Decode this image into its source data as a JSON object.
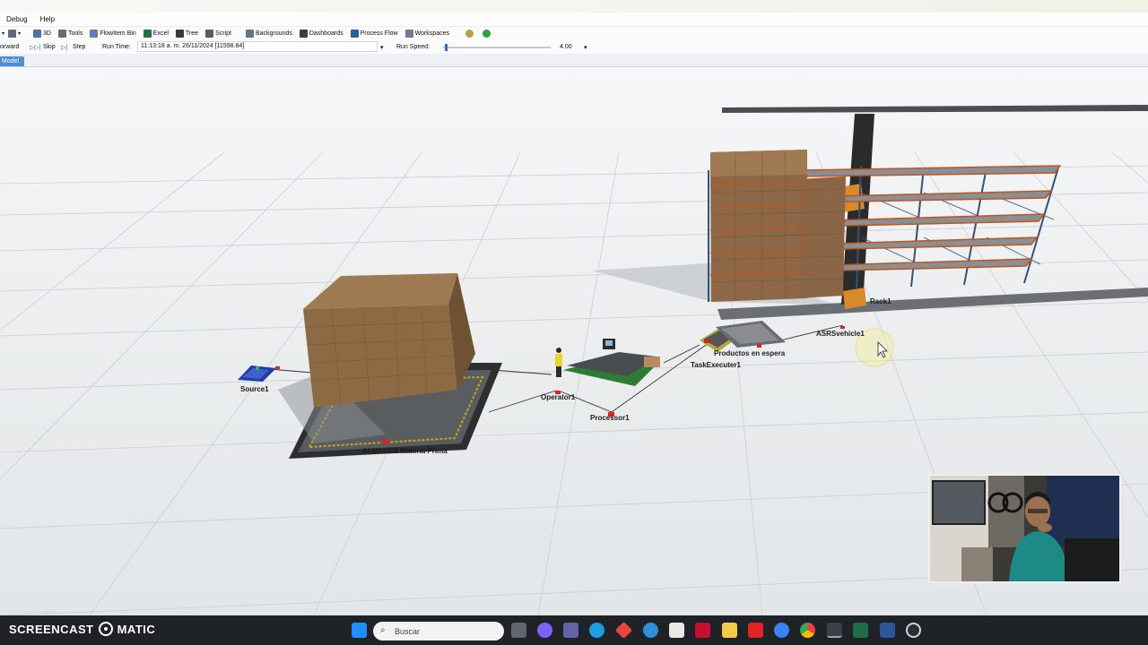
{
  "menu": {
    "items": [
      "Debug",
      "Help"
    ]
  },
  "toolbar": {
    "items": [
      {
        "label": "3D",
        "icon": "3d-view-icon",
        "color": "#4f6fa8"
      },
      {
        "label": "Tools",
        "icon": "tools-icon",
        "color": "#6b6b6b"
      },
      {
        "label": "FlowItem Bin",
        "icon": "flowitem-bin-icon",
        "color": "#5a7fb3"
      },
      {
        "label": "Excel",
        "icon": "excel-icon",
        "color": "#207245"
      },
      {
        "label": "Tree",
        "icon": "tree-icon",
        "color": "#3a3a3a"
      },
      {
        "label": "Script",
        "icon": "script-icon",
        "color": "#555d66"
      },
      {
        "label": "Backgrounds",
        "icon": "backgrounds-icon",
        "color": "#64748b"
      },
      {
        "label": "Dashboards",
        "icon": "dashboards-icon",
        "color": "#3d3d3d"
      },
      {
        "label": "Process Flow",
        "icon": "process-flow-icon",
        "color": "#2f5e9e"
      },
      {
        "label": "Workspaces",
        "icon": "workspaces-icon",
        "color": "#6f7c91"
      }
    ]
  },
  "runbar": {
    "forward_label": "orward",
    "skip_label": "Skip",
    "step_label": "Step",
    "run_time_label": "Run Time:",
    "run_time_value": "11:13:18 a. m.  26/11/2024  [11598.84]",
    "run_speed_label": "Run Speed:",
    "run_speed_value": "4.00"
  },
  "tab": {
    "label": "Model"
  },
  "scene": {
    "labels": {
      "source": "Source1",
      "almacen": "ALMACEN Materia Prima",
      "operator": "Operator1",
      "processor": "Processor1",
      "taskexecuter": "TaskExecuter1",
      "productos": "Productos en espera",
      "asrs": "ASRSvehicle1",
      "rack": "Rack1"
    }
  },
  "watermark": {
    "recorded_with": "RECORDED WITH",
    "brand_left": "SCREENCAST",
    "brand_right": "MATIC"
  },
  "taskbar": {
    "search_placeholder": "Buscar",
    "apps": [
      {
        "icon": "file-explorer-task-icon",
        "color": "#f0b429"
      },
      {
        "icon": "copilot-task-icon",
        "color": "#7b61ff"
      },
      {
        "icon": "teams-task-icon",
        "color": "#6264a7"
      },
      {
        "icon": "edge-task-icon",
        "color": "#1f9de0"
      },
      {
        "icon": "office-task-icon",
        "color": "#e5473b"
      },
      {
        "icon": "settings-task-icon",
        "color": "#2f8fdc"
      },
      {
        "icon": "store-task-icon",
        "color": "#e8e8e8"
      },
      {
        "icon": "mcafee-task-icon",
        "color": "#c8102e"
      },
      {
        "icon": "folder-task-icon",
        "color": "#f7c948"
      },
      {
        "icon": "youtube-task-icon",
        "color": "#e02424"
      },
      {
        "icon": "media-task-icon",
        "color": "#3b82f6"
      },
      {
        "icon": "chrome-task-icon",
        "color": "#34a853"
      },
      {
        "icon": "flexsim-task-icon",
        "color": "#9aa3ad"
      },
      {
        "icon": "excel-task-icon",
        "color": "#1d7044"
      },
      {
        "icon": "word-task-icon",
        "color": "#2b579a"
      },
      {
        "icon": "obs-task-icon",
        "color": "#cfd4da"
      }
    ]
  }
}
